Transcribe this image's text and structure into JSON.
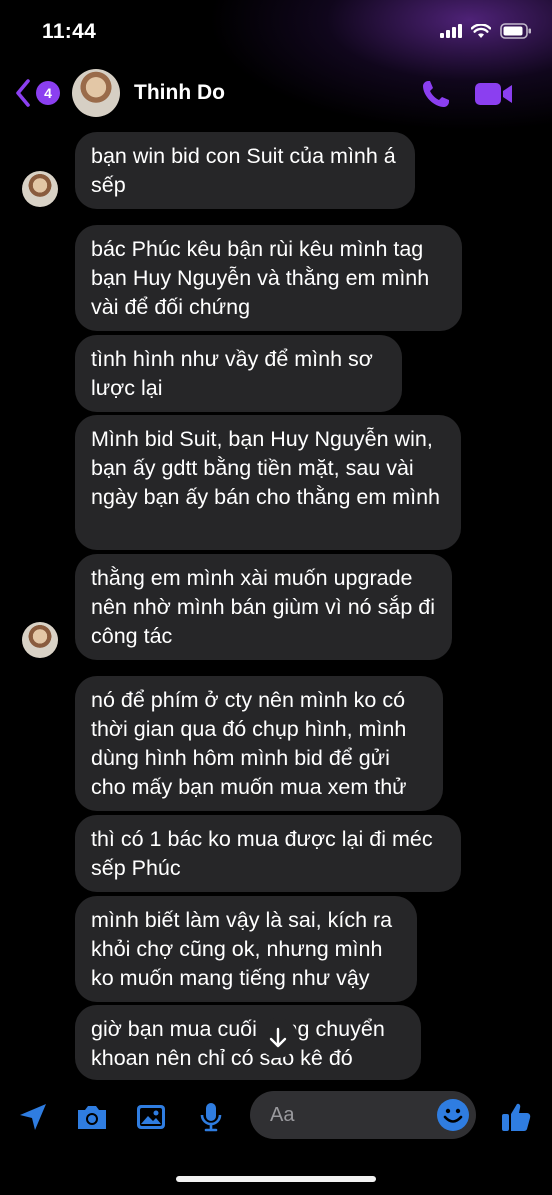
{
  "status_bar": {
    "time": "11:44"
  },
  "header": {
    "back_badge_count": "4",
    "contact_name": "Thinh Do"
  },
  "messages": [
    {
      "text": "bạn win bid con Suit của mình á sếp"
    },
    {
      "text": "bác Phúc kêu bận rùi kêu mình tag bạn Huy Nguyễn và thằng em mình vài để đối chứng"
    },
    {
      "text": "tình hình như vầy để mình sơ lược lại"
    },
    {
      "text": "Mình bid Suit, bạn Huy Nguyễn win, bạn ấy gdtt bằng tiền mặt, sau vài ngày bạn ấy bán cho thằng em mình"
    },
    {
      "text": "thằng em mình xài muốn upgrade nên nhờ mình bán giùm vì nó sắp đi công tác"
    },
    {
      "text": "nó để phím ở cty nên mình ko có thời gian qua đó chụp hình, mình dùng hình hôm mình bid để gửi cho mấy bạn muốn mua xem thử"
    },
    {
      "text": "thì có 1 bác ko mua được lại đi méc sếp Phúc"
    },
    {
      "text": "mình biết làm vậy là sai, kích ra khỏi chợ cũng ok, nhưng mình ko muốn mang tiếng như vậy"
    },
    {
      "text": "giờ bạn mua cuối cùng chuyển khoan nên chỉ có sao kê đó"
    }
  ],
  "composer": {
    "placeholder": "Aa"
  },
  "icons": {
    "accent_color": "#8b3ff0",
    "action_color": "#2f7de1"
  }
}
